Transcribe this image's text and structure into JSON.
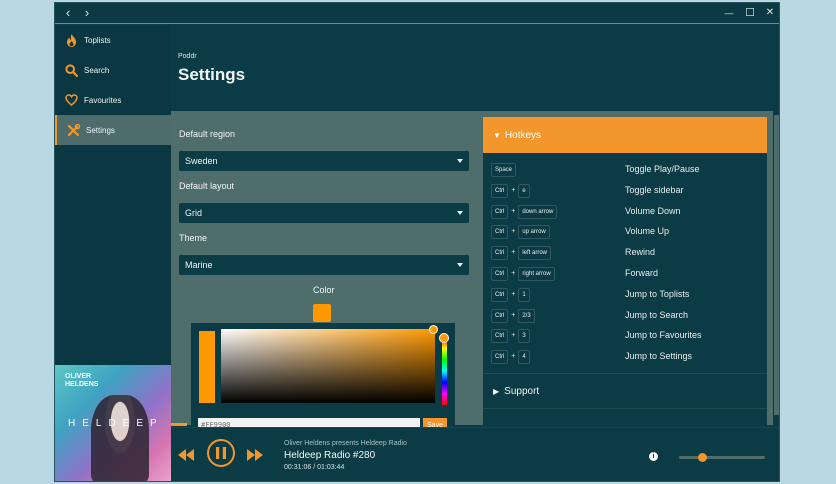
{
  "window": {
    "controls": {
      "back": "‹",
      "forward": "›",
      "minimize": "—",
      "maximize": "☐",
      "close": "✕"
    }
  },
  "sidebar": {
    "items": [
      {
        "label": "Toplists",
        "icon": "flame-icon"
      },
      {
        "label": "Search",
        "icon": "search-icon"
      },
      {
        "label": "Favourites",
        "icon": "heart-icon"
      },
      {
        "label": "Settings",
        "icon": "tools-icon",
        "active": true
      }
    ]
  },
  "header": {
    "breadcrumb": "Poddr",
    "title": "Settings"
  },
  "settings": {
    "region_label": "Default region",
    "region_value": "Sweden",
    "layout_label": "Default layout",
    "layout_value": "Grid",
    "theme_label": "Theme",
    "theme_value": "Marine",
    "color_label": "Color",
    "color_value": "#ff9900"
  },
  "picker": {
    "hex_placeholder": "#FF9900",
    "save_label": "Save"
  },
  "hotkeys": {
    "title": "Hotkeys",
    "rows": [
      {
        "keys": [
          "Space"
        ],
        "action": "Toggle Play/Pause"
      },
      {
        "keys": [
          "Ctrl",
          "e"
        ],
        "action": "Toggle sidebar"
      },
      {
        "keys": [
          "Ctrl",
          "down arrow"
        ],
        "action": "Volume Down"
      },
      {
        "keys": [
          "Ctrl",
          "up arrow"
        ],
        "action": "Volume Up"
      },
      {
        "keys": [
          "Ctrl",
          "left arrow"
        ],
        "action": "Rewind"
      },
      {
        "keys": [
          "Ctrl",
          "right arrow"
        ],
        "action": "Forward"
      },
      {
        "keys": [
          "Ctrl",
          "1"
        ],
        "action": "Jump to Toplists"
      },
      {
        "keys": [
          "Ctrl",
          "2/3"
        ],
        "action": "Jump to Search"
      },
      {
        "keys": [
          "Ctrl",
          "3"
        ],
        "action": "Jump to Favourites"
      },
      {
        "keys": [
          "Ctrl",
          "4"
        ],
        "action": "Jump to Settings"
      }
    ],
    "plus": "+"
  },
  "support": {
    "title": "Support"
  },
  "album": {
    "artist_line1": "OLIVER",
    "artist_line2": "HELDENS",
    "word": "HELDEEP"
  },
  "player": {
    "subtitle": "Oliver Heldens presents Heldeep Radio",
    "title": "Heldeep Radio #280",
    "time": "00:31:06 / 01:03:44",
    "progress_fraction": 0.49,
    "volume_fraction": 0.27,
    "info_label": "i"
  },
  "colors": {
    "accent": "#f3962b",
    "background": "#0b3b45",
    "panel": "#4e6d6b"
  }
}
